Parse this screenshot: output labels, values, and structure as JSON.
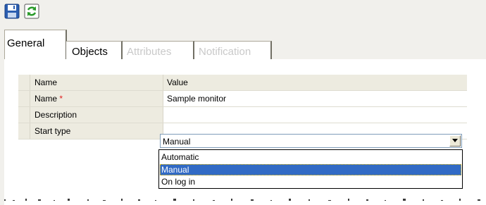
{
  "toolbar": {
    "buttons": [
      {
        "icon": "save-icon"
      },
      {
        "icon": "refresh-icon"
      }
    ]
  },
  "tabs": [
    {
      "label": "General",
      "active": true,
      "enabled": true
    },
    {
      "label": "Objects",
      "active": false,
      "enabled": true
    },
    {
      "label": "Attributes",
      "active": false,
      "enabled": false
    },
    {
      "label": "Notification",
      "active": false,
      "enabled": false
    }
  ],
  "grid": {
    "headers": {
      "name": "Name",
      "value": "Value"
    },
    "rows": [
      {
        "name": "Name",
        "required_mark": "*",
        "value": "Sample monitor"
      },
      {
        "name": "Description",
        "value": ""
      },
      {
        "name": "Start type",
        "value": "Manual"
      }
    ]
  },
  "start_type_dropdown": {
    "selected": "Manual",
    "options": [
      "Automatic",
      "Manual",
      "On log in"
    ]
  },
  "colors": {
    "selection": "#316ac5",
    "required": "#e02020",
    "grid_header": "#edebe0"
  }
}
